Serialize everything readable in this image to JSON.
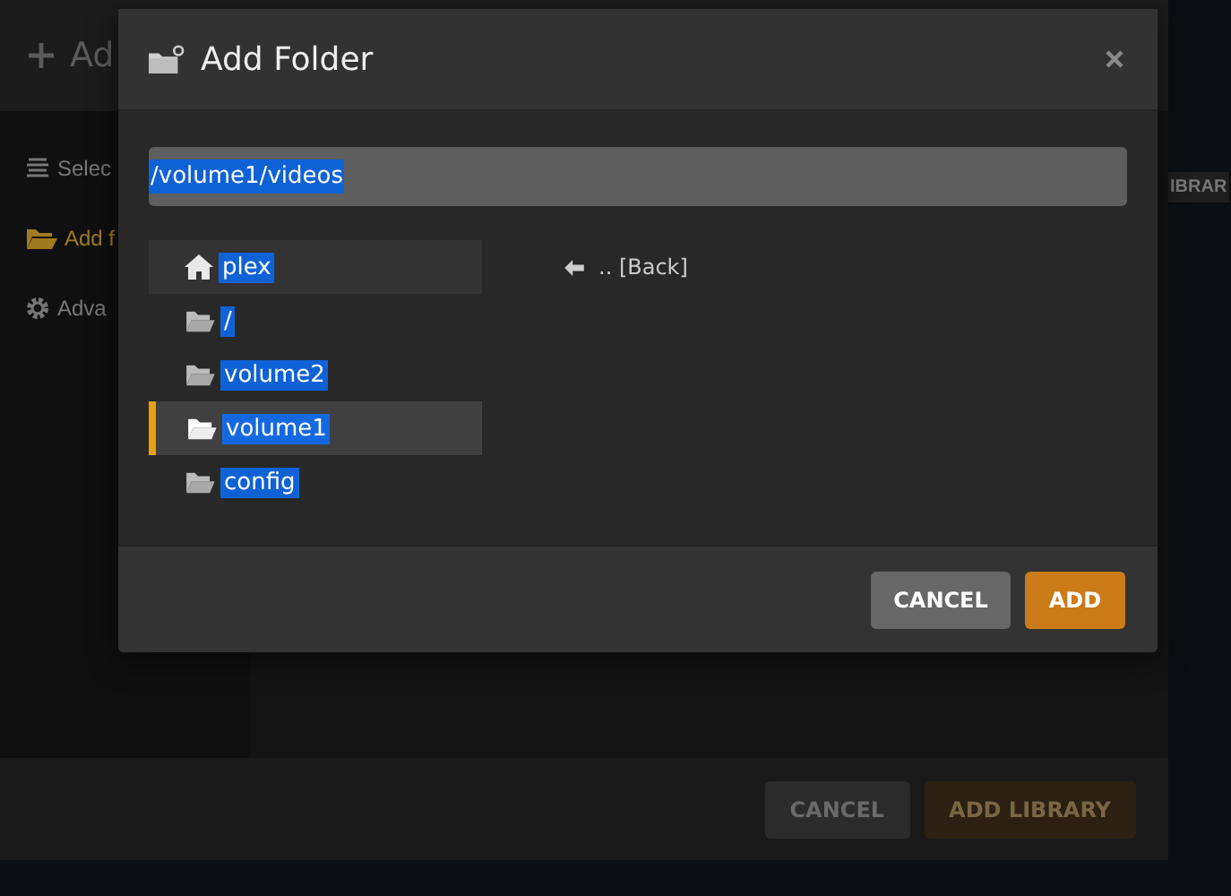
{
  "background_dialog": {
    "title": "Ad",
    "sidebar": [
      {
        "label": "Selec",
        "kind": "list",
        "selected": false
      },
      {
        "label": "Add f",
        "kind": "folder",
        "selected": true
      },
      {
        "label": "Adva",
        "kind": "gear",
        "selected": false
      }
    ],
    "side_label": "IBRAR",
    "buttons": [
      {
        "label": "CANCEL",
        "kind": "secondary"
      },
      {
        "label": "ADD LIBRARY",
        "kind": "primary"
      }
    ]
  },
  "dialog": {
    "title": "Add Folder",
    "path": "/volume1/videos",
    "folders": [
      {
        "label": "plex",
        "kind": "home",
        "selected": false
      },
      {
        "label": "/",
        "kind": "folder",
        "selected": false
      },
      {
        "label": "volume2",
        "kind": "folder",
        "selected": false
      },
      {
        "label": "volume1",
        "kind": "folder",
        "selected": true
      },
      {
        "label": "config",
        "kind": "folder",
        "selected": false
      }
    ],
    "back": ".. [Back]",
    "buttons": [
      {
        "label": "CANCEL",
        "kind": "secondary"
      },
      {
        "label": "ADD",
        "kind": "primary"
      }
    ]
  }
}
